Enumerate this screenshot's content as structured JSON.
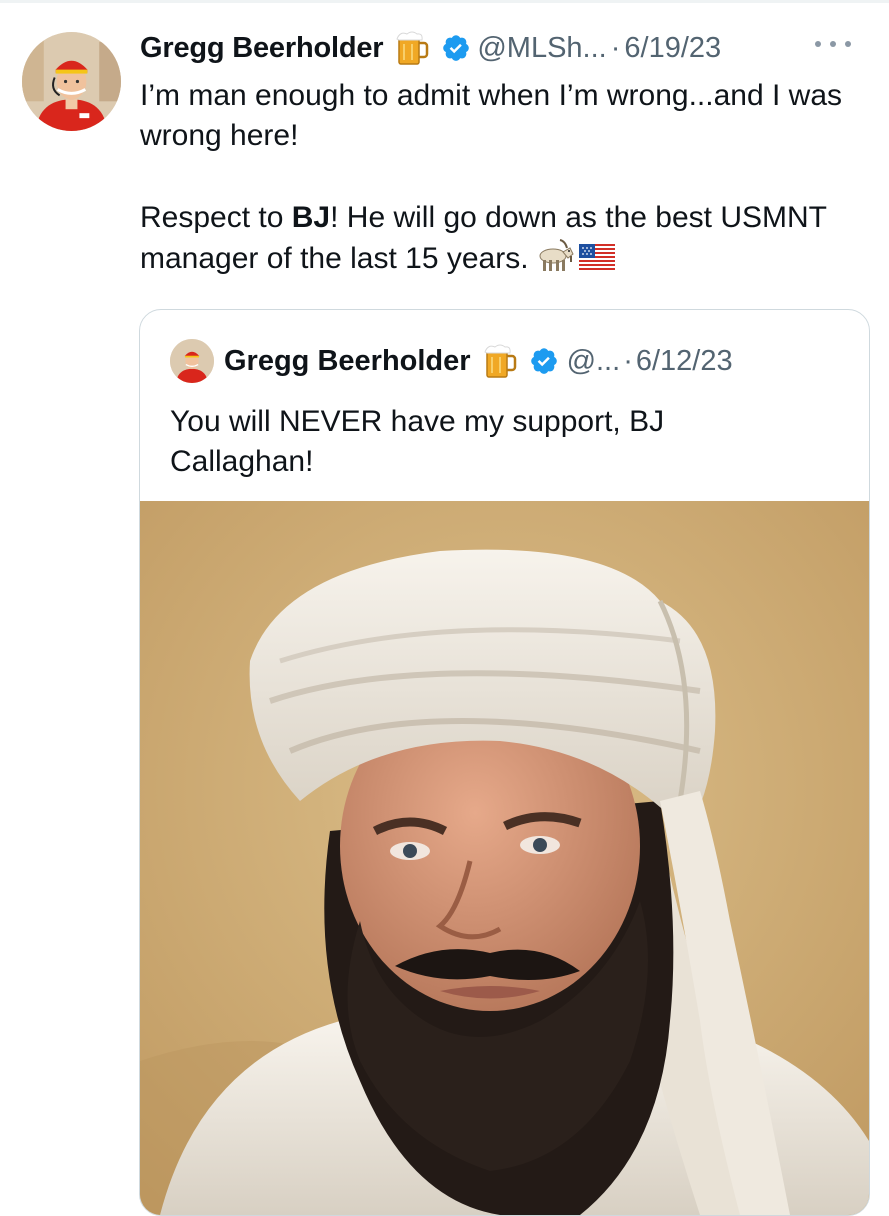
{
  "tweet": {
    "display_name": "Gregg Beerholder",
    "name_emoji": "beer-mug-icon",
    "handle": "@MLSh...",
    "separator": "·",
    "date": "6/19/23",
    "text_line1": "I’m man enough to admit when I’m wrong...and I was wrong here!",
    "text_pre": "Respect to ",
    "text_bold": "BJ",
    "text_post": "! He will go down as the best USMNT manager of the last 15 years.",
    "trailing_emoji": [
      "goat-icon",
      "us-flag-icon"
    ]
  },
  "quoted_tweet": {
    "display_name": "Gregg Beerholder",
    "name_emoji": "beer-mug-icon",
    "handle": "@...",
    "separator": "·",
    "date": "6/12/23",
    "text": "You will NEVER have my support, BJ Callaghan!",
    "image": "photo of a bearded man wearing a white turban"
  },
  "colors": {
    "text_primary": "#0f1419",
    "text_secondary": "#536471",
    "verified_blue": "#1d9bf0",
    "border": "#cfd9de"
  }
}
